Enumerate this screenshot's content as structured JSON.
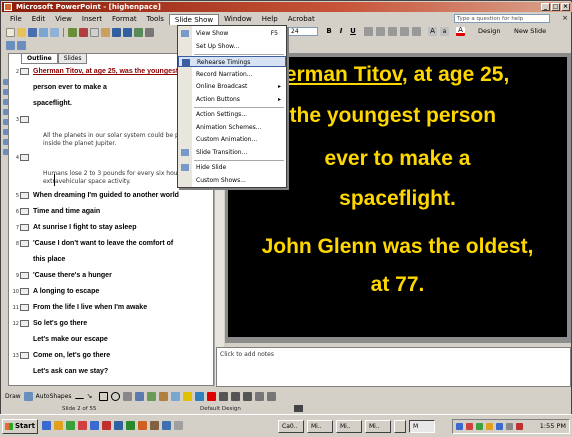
{
  "title": "Microsoft PowerPoint - [highenpace]",
  "menu": [
    "File",
    "Edit",
    "View",
    "Insert",
    "Format",
    "Tools",
    "Slide Show",
    "Window",
    "Help",
    "Acrobat"
  ],
  "ask_placeholder": "Type a question for help",
  "toolbar": {
    "font_size": "24",
    "design_label": "Design",
    "new_slide_label": "New Slide",
    "bold": "B",
    "italic": "I",
    "underline": "U"
  },
  "slide_show_menu": [
    {
      "label": "View Show",
      "shortcut": "F5"
    },
    {
      "label": "Set Up Show..."
    },
    {
      "label": "Rehearse Timings",
      "selected": true
    },
    {
      "label": "Record Narration..."
    },
    {
      "label": "Online Broadcast",
      "submenu": true
    },
    {
      "label": "Action Buttons",
      "submenu": true
    },
    {
      "label": "Action Settings..."
    },
    {
      "label": "Animation Schemes..."
    },
    {
      "label": "Custom Animation..."
    },
    {
      "label": "Slide Transition..."
    },
    {
      "label": "Hide Slide"
    },
    {
      "label": "Custom Shows..."
    }
  ],
  "outline_tabs": [
    "Outline",
    "Slides"
  ],
  "outline": [
    {
      "num": "2",
      "text": "Gherman Titov, at age 25, was the youngest",
      "icon": true,
      "red": true
    },
    {
      "num": "",
      "text": "person ever to make a",
      "icon": false
    },
    {
      "num": "",
      "text": "spaceflight.",
      "icon": false
    },
    {
      "num": "3",
      "text": "",
      "icon": true
    },
    {
      "num": "",
      "sub": "All the planets in our solar system could be placed inside the planet Jupiter."
    },
    {
      "num": "4",
      "text": "",
      "icon": true
    },
    {
      "num": "",
      "sub": "Humans lose 2 to 3 pounds for every six hours of extravehicular space activity."
    },
    {
      "num": "5",
      "text": "When dreaming I'm guided to another world",
      "icon": true
    },
    {
      "num": "6",
      "text": "Time and time again",
      "icon": true
    },
    {
      "num": "7",
      "text": "At sunrise I fight to stay asleep",
      "icon": true
    },
    {
      "num": "8",
      "text": "'Cause I don't want to leave the comfort of",
      "icon": true
    },
    {
      "num": "",
      "text": "this place",
      "icon": false
    },
    {
      "num": "9",
      "text": "'Cause there's a hunger",
      "icon": true
    },
    {
      "num": "10",
      "text": "A longing to escape",
      "icon": true
    },
    {
      "num": "11",
      "text": "From the life I live when I'm awake",
      "icon": true
    },
    {
      "num": "12",
      "text": "So let's go there",
      "icon": true
    },
    {
      "num": "",
      "text": "Let's make our escape",
      "icon": false
    },
    {
      "num": "13",
      "text": "Come on, let's go there",
      "icon": true
    },
    {
      "num": "",
      "text": "Let's ask can we stay?",
      "icon": false
    }
  ],
  "slide": {
    "line1_rest": ", at age 25,",
    "line1_name": "herman Titov",
    "line2": "s the youngest person",
    "line3": "ever to make a",
    "line4": "spaceflight.",
    "line5": "John Glenn was the oldest,",
    "line6": "at 77."
  },
  "notes_placeholder": "Click to add notes",
  "draw": {
    "draw_label": "Draw",
    "autoshapes_label": "AutoShapes"
  },
  "status": {
    "slide": "Slide 2 of 55",
    "design": "Default Design"
  },
  "taskbar": {
    "start": "Start",
    "tasks": [
      "Ca0..",
      "Mi..",
      "Mi..",
      "Mi..",
      "",
      "M"
    ],
    "clock": "1:55 PM"
  },
  "colors": {
    "slide_bg": "#000000",
    "slide_text": "#FFD700",
    "title_bar": "#8a1d0a",
    "menu_highlight": "#d7e3f5"
  }
}
